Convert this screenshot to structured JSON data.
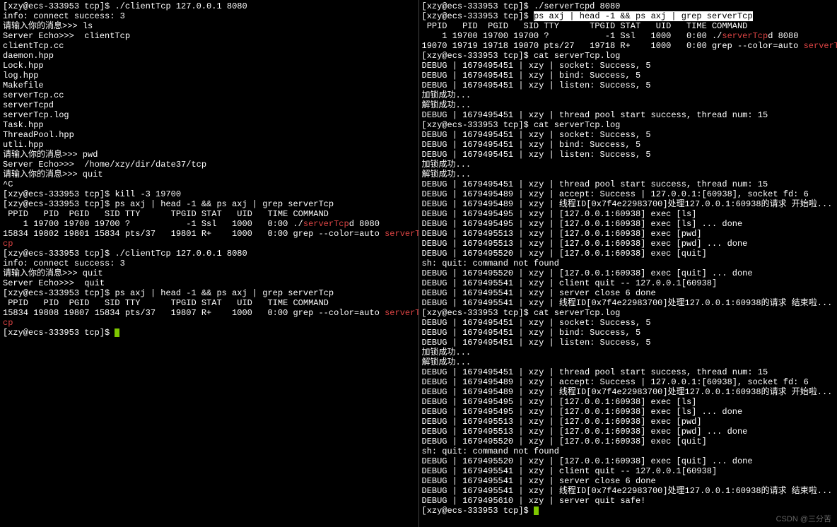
{
  "prompt": "[xzy@ecs-333953 tcp]$ ",
  "colors": {
    "green": "#7ec700",
    "red": "#d44"
  },
  "watermark": "CSDN @三分苦",
  "left": {
    "lines": [
      {
        "t": "prompt",
        "cmd": "./clientTcp 127.0.0.1 8080"
      },
      {
        "t": "plain",
        "txt": "info: connect success: 3"
      },
      {
        "t": "plain",
        "txt": "请输入你的消息>>> ls"
      },
      {
        "t": "plain",
        "txt": "Server Echo>>>  clientTcp"
      },
      {
        "t": "plain",
        "txt": "clientTcp.cc"
      },
      {
        "t": "plain",
        "txt": "daemon.hpp"
      },
      {
        "t": "plain",
        "txt": "Lock.hpp"
      },
      {
        "t": "plain",
        "txt": "log.hpp"
      },
      {
        "t": "plain",
        "txt": "Makefile"
      },
      {
        "t": "plain",
        "txt": "serverTcp.cc"
      },
      {
        "t": "plain",
        "txt": "serverTcpd"
      },
      {
        "t": "plain",
        "txt": "serverTcp.log"
      },
      {
        "t": "plain",
        "txt": "Task.hpp"
      },
      {
        "t": "plain",
        "txt": "ThreadPool.hpp"
      },
      {
        "t": "plain",
        "txt": "utli.hpp"
      },
      {
        "t": "plain",
        "txt": ""
      },
      {
        "t": "plain",
        "txt": "请输入你的消息>>> pwd"
      },
      {
        "t": "plain",
        "txt": "Server Echo>>>  /home/xzy/dir/date37/tcp"
      },
      {
        "t": "plain",
        "txt": ""
      },
      {
        "t": "plain",
        "txt": "请输入你的消息>>> quit"
      },
      {
        "t": "plain",
        "txt": "^C"
      },
      {
        "t": "prompt",
        "cmd": "kill -3 19700"
      },
      {
        "t": "prompt",
        "cmd": "ps axj | head -1 && ps axj | grep serverTcp"
      },
      {
        "t": "plain",
        "txt": " PPID   PID  PGID   SID TTY      TPGID STAT   UID   TIME COMMAND"
      },
      {
        "t": "mix",
        "parts": [
          {
            "txt": "    1 19700 19700 19700 ?           -1 Ssl   1000   0:00 ./"
          },
          {
            "txt": "serverTcp",
            "cls": "red"
          },
          {
            "txt": "d 8080"
          }
        ]
      },
      {
        "t": "mix",
        "parts": [
          {
            "txt": "15834 19802 19801 15834 pts/37   19801 R+    1000   0:00 grep --color=auto "
          },
          {
            "txt": "serverT",
            "cls": "red"
          }
        ]
      },
      {
        "t": "mix",
        "parts": [
          {
            "txt": "cp",
            "cls": "red"
          }
        ]
      },
      {
        "t": "prompt",
        "cmd": "./clientTcp 127.0.0.1 8080"
      },
      {
        "t": "plain",
        "txt": "info: connect success: 3"
      },
      {
        "t": "plain",
        "txt": "请输入你的消息>>> quit"
      },
      {
        "t": "plain",
        "txt": "Server Echo>>>  quit"
      },
      {
        "t": "prompt",
        "cmd": "ps axj | head -1 && ps axj | grep serverTcp"
      },
      {
        "t": "plain",
        "txt": " PPID   PID  PGID   SID TTY      TPGID STAT   UID   TIME COMMAND"
      },
      {
        "t": "mix",
        "parts": [
          {
            "txt": "15834 19808 19807 15834 pts/37   19807 R+    1000   0:00 grep --color=auto "
          },
          {
            "txt": "serverT",
            "cls": "red"
          }
        ]
      },
      {
        "t": "mix",
        "parts": [
          {
            "txt": "cp",
            "cls": "red"
          }
        ]
      },
      {
        "t": "prompt",
        "cmd": "",
        "cursor": true
      }
    ]
  },
  "right": {
    "lines": [
      {
        "t": "prompt",
        "cmd": "./serverTcpd 8080"
      },
      {
        "t": "mix",
        "parts": [
          {
            "txt": "[xzy@ecs-333953 tcp]$ "
          },
          {
            "txt": "ps axj | head -1 && ps axj | grep serverTcp",
            "cls": "inv"
          }
        ]
      },
      {
        "t": "plain",
        "txt": " PPID   PID  PGID   SID TTY      TPGID STAT   UID   TIME COMMAND"
      },
      {
        "t": "mix",
        "parts": [
          {
            "txt": "    1 19700 19700 19700 ?           -1 Ssl   1000   0:00 ./"
          },
          {
            "txt": "serverTcp",
            "cls": "red"
          },
          {
            "txt": "d 8080"
          }
        ]
      },
      {
        "t": "mix",
        "parts": [
          {
            "txt": "19070 19719 19718 19070 pts/27   19718 R+    1000   0:00 grep --color=auto "
          },
          {
            "txt": "serverTcp",
            "cls": "red"
          }
        ]
      },
      {
        "t": "prompt",
        "cmd": "cat serverTcp.log"
      },
      {
        "t": "plain",
        "txt": "DEBUG | 1679495451 | xzy | socket: Success, 5"
      },
      {
        "t": "plain",
        "txt": "DEBUG | 1679495451 | xzy | bind: Success, 5"
      },
      {
        "t": "plain",
        "txt": "DEBUG | 1679495451 | xzy | listen: Success, 5"
      },
      {
        "t": "plain",
        "txt": "加锁成功..."
      },
      {
        "t": "plain",
        "txt": "解锁成功..."
      },
      {
        "t": "plain",
        "txt": "DEBUG | 1679495451 | xzy | thread pool start success, thread num: 15"
      },
      {
        "t": "prompt",
        "cmd": "cat serverTcp.log"
      },
      {
        "t": "plain",
        "txt": "DEBUG | 1679495451 | xzy | socket: Success, 5"
      },
      {
        "t": "plain",
        "txt": "DEBUG | 1679495451 | xzy | bind: Success, 5"
      },
      {
        "t": "plain",
        "txt": "DEBUG | 1679495451 | xzy | listen: Success, 5"
      },
      {
        "t": "plain",
        "txt": "加锁成功..."
      },
      {
        "t": "plain",
        "txt": "解锁成功..."
      },
      {
        "t": "plain",
        "txt": "DEBUG | 1679495451 | xzy | thread pool start success, thread num: 15"
      },
      {
        "t": "plain",
        "txt": "DEBUG | 1679495489 | xzy | accept: Success | 127.0.0.1:[60938], socket fd: 6"
      },
      {
        "t": "plain",
        "txt": "DEBUG | 1679495489 | xzy | 线程ID[0x7f4e22983700]处理127.0.0.1:60938的请求 开始啦..."
      },
      {
        "t": "plain",
        "txt": "DEBUG | 1679495495 | xzy | [127.0.0.1:60938] exec [ls]"
      },
      {
        "t": "plain",
        "txt": "DEBUG | 1679495495 | xzy | [127.0.0.1:60938] exec [ls] ... done"
      },
      {
        "t": "plain",
        "txt": "DEBUG | 1679495513 | xzy | [127.0.0.1:60938] exec [pwd]"
      },
      {
        "t": "plain",
        "txt": "DEBUG | 1679495513 | xzy | [127.0.0.1:60938] exec [pwd] ... done"
      },
      {
        "t": "plain",
        "txt": "DEBUG | 1679495520 | xzy | [127.0.0.1:60938] exec [quit]"
      },
      {
        "t": "plain",
        "txt": "sh: quit: command not found"
      },
      {
        "t": "plain",
        "txt": "DEBUG | 1679495520 | xzy | [127.0.0.1:60938] exec [quit] ... done"
      },
      {
        "t": "plain",
        "txt": "DEBUG | 1679495541 | xzy | client quit -- 127.0.0.1[60938]"
      },
      {
        "t": "plain",
        "txt": "DEBUG | 1679495541 | xzy | server close 6 done"
      },
      {
        "t": "plain",
        "txt": "DEBUG | 1679495541 | xzy | 线程ID[0x7f4e22983700]处理127.0.0.1:60938的请求 结束啦..."
      },
      {
        "t": "prompt",
        "cmd": "cat serverTcp.log"
      },
      {
        "t": "plain",
        "txt": "DEBUG | 1679495451 | xzy | socket: Success, 5"
      },
      {
        "t": "plain",
        "txt": "DEBUG | 1679495451 | xzy | bind: Success, 5"
      },
      {
        "t": "plain",
        "txt": "DEBUG | 1679495451 | xzy | listen: Success, 5"
      },
      {
        "t": "plain",
        "txt": "加锁成功..."
      },
      {
        "t": "plain",
        "txt": "解锁成功..."
      },
      {
        "t": "plain",
        "txt": "DEBUG | 1679495451 | xzy | thread pool start success, thread num: 15"
      },
      {
        "t": "plain",
        "txt": "DEBUG | 1679495489 | xzy | accept: Success | 127.0.0.1:[60938], socket fd: 6"
      },
      {
        "t": "plain",
        "txt": "DEBUG | 1679495489 | xzy | 线程ID[0x7f4e22983700]处理127.0.0.1:60938的请求 开始啦..."
      },
      {
        "t": "plain",
        "txt": "DEBUG | 1679495495 | xzy | [127.0.0.1:60938] exec [ls]"
      },
      {
        "t": "plain",
        "txt": "DEBUG | 1679495495 | xzy | [127.0.0.1:60938] exec [ls] ... done"
      },
      {
        "t": "plain",
        "txt": "DEBUG | 1679495513 | xzy | [127.0.0.1:60938] exec [pwd]"
      },
      {
        "t": "plain",
        "txt": "DEBUG | 1679495513 | xzy | [127.0.0.1:60938] exec [pwd] ... done"
      },
      {
        "t": "plain",
        "txt": "DEBUG | 1679495520 | xzy | [127.0.0.1:60938] exec [quit]"
      },
      {
        "t": "plain",
        "txt": "sh: quit: command not found"
      },
      {
        "t": "plain",
        "txt": "DEBUG | 1679495520 | xzy | [127.0.0.1:60938] exec [quit] ... done"
      },
      {
        "t": "plain",
        "txt": "DEBUG | 1679495541 | xzy | client quit -- 127.0.0.1[60938]"
      },
      {
        "t": "plain",
        "txt": "DEBUG | 1679495541 | xzy | server close 6 done"
      },
      {
        "t": "plain",
        "txt": "DEBUG | 1679495541 | xzy | 线程ID[0x7f4e22983700]处理127.0.0.1:60938的请求 结束啦..."
      },
      {
        "t": "plain",
        "txt": "DEBUG | 1679495610 | xzy | server quit safe!"
      },
      {
        "t": "prompt",
        "cmd": "",
        "cursor": true
      }
    ]
  }
}
